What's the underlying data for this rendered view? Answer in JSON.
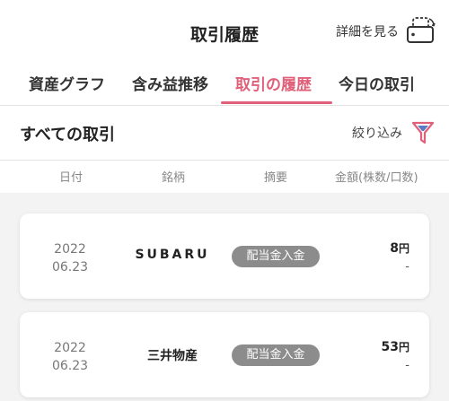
{
  "header": {
    "title": "取引履歴",
    "detail_label": "詳細を見る",
    "detail_icon": "rotate-screen-icon"
  },
  "tabs": [
    {
      "label": "資産グラフ",
      "active": false
    },
    {
      "label": "含み益推移",
      "active": false
    },
    {
      "label": "取引の履歴",
      "active": true
    },
    {
      "label": "今日の取引",
      "active": false
    }
  ],
  "filter": {
    "heading": "すべての取引",
    "button_label": "絞り込み",
    "icon": "funnel-icon"
  },
  "columns": {
    "date": "日付",
    "brand": "銘柄",
    "summary": "摘要",
    "amount": "金額(株数/口数)"
  },
  "rows": [
    {
      "date_year": "2022",
      "date_md": "06.23",
      "brand": "SUBARU",
      "summary": "配当金入金",
      "amount_value": "8",
      "amount_unit": "円",
      "quantity": "-"
    },
    {
      "date_year": "2022",
      "date_md": "06.23",
      "brand": "三井物産",
      "summary": "配当金入金",
      "amount_value": "53",
      "amount_unit": "円",
      "quantity": "-"
    }
  ],
  "colors": {
    "accent": "#e0607a",
    "badge": "#8c8c8c",
    "background": "#f3f3f4"
  }
}
